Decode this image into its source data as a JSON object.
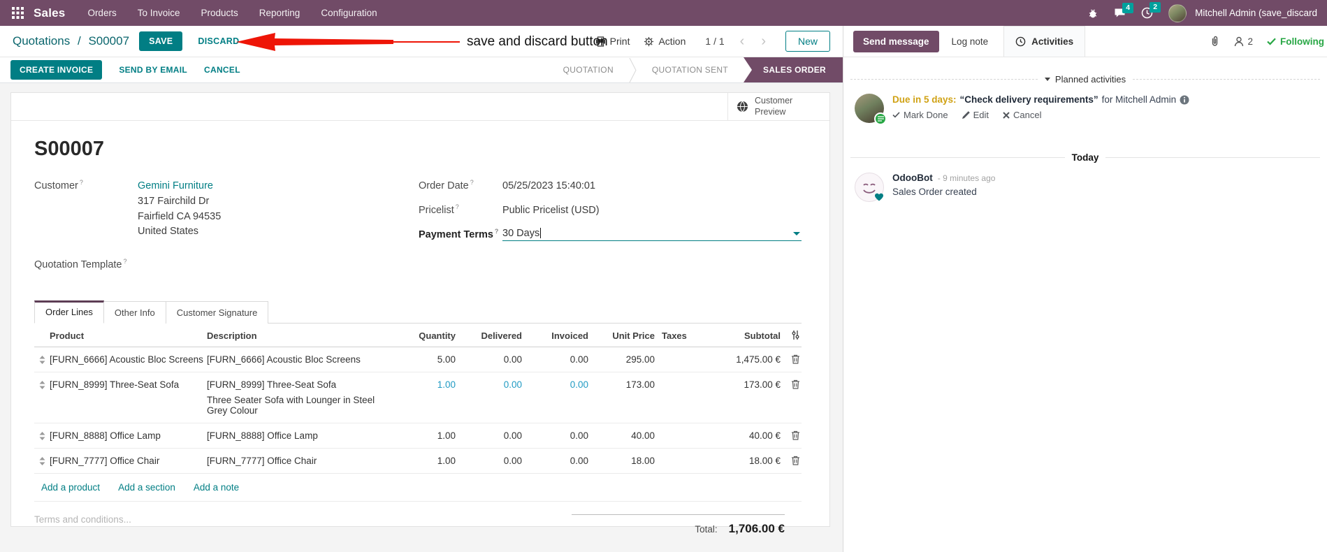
{
  "topnav": {
    "app_name": "Sales",
    "menus": [
      "Orders",
      "To Invoice",
      "Products",
      "Reporting",
      "Configuration"
    ],
    "messages_badge": "4",
    "activities_badge": "2",
    "user_name": "Mitchell Admin (save_discard"
  },
  "control_panel": {
    "breadcrumb_parent": "Quotations",
    "breadcrumb_sep": "/",
    "breadcrumb_current": "S00007",
    "save_label": "SAVE",
    "discard_label": "DISCARD",
    "annotation_text": "save and discard button",
    "print_label": "Print",
    "action_label": "Action",
    "pager": "1 / 1",
    "prev_label": "‹",
    "next_label": "›",
    "new_label": "New"
  },
  "statusbar": {
    "buttons": [
      "CREATE INVOICE",
      "SEND BY EMAIL",
      "CANCEL"
    ],
    "stages": [
      "QUOTATION",
      "QUOTATION SENT",
      "SALES ORDER"
    ],
    "active_stage": "SALES ORDER"
  },
  "sheet": {
    "customer_preview_label": "Customer Preview",
    "title": "S00007",
    "fields": {
      "customer_label": "Customer",
      "customer_name": "Gemini Furniture",
      "customer_address": [
        "317 Fairchild Dr",
        "Fairfield CA 94535",
        "United States"
      ],
      "quotation_template_label": "Quotation Template",
      "order_date_label": "Order Date",
      "order_date": "05/25/2023 15:40:01",
      "pricelist_label": "Pricelist",
      "pricelist": "Public Pricelist (USD)",
      "payment_terms_label": "Payment Terms",
      "payment_terms": "30 Days"
    },
    "tabs": [
      "Order Lines",
      "Other Info",
      "Customer Signature"
    ],
    "order_lines": {
      "columns": [
        "Product",
        "Description",
        "Quantity",
        "Delivered",
        "Invoiced",
        "Unit Price",
        "Taxes",
        "Subtotal"
      ],
      "rows": [
        {
          "product": "[FURN_6666] Acoustic Bloc Screens",
          "description": "[FURN_6666] Acoustic Bloc Screens",
          "description2": "",
          "quantity": "5.00",
          "delivered": "0.00",
          "invoiced": "0.00",
          "unit_price": "295.00",
          "taxes": "",
          "subtotal": "1,475.00 €"
        },
        {
          "product": "[FURN_8999] Three-Seat Sofa",
          "description": "[FURN_8999] Three-Seat Sofa",
          "description2": "Three Seater Sofa with Lounger in Steel Grey Colour",
          "quantity": "1.00",
          "delivered": "0.00",
          "invoiced": "0.00",
          "unit_price": "173.00",
          "taxes": "",
          "subtotal": "173.00 €"
        },
        {
          "product": "[FURN_8888] Office Lamp",
          "description": "[FURN_8888] Office Lamp",
          "description2": "",
          "quantity": "1.00",
          "delivered": "0.00",
          "invoiced": "0.00",
          "unit_price": "40.00",
          "taxes": "",
          "subtotal": "40.00 €"
        },
        {
          "product": "[FURN_7777] Office Chair",
          "description": "[FURN_7777] Office Chair",
          "description2": "",
          "quantity": "1.00",
          "delivered": "0.00",
          "invoiced": "0.00",
          "unit_price": "18.00",
          "taxes": "",
          "subtotal": "18.00 €"
        }
      ],
      "links": [
        "Add a product",
        "Add a section",
        "Add a note"
      ]
    },
    "terms_placeholder": "Terms and conditions...",
    "total_label": "Total:",
    "total_value": "1,706.00 €"
  },
  "chatter": {
    "send_message_label": "Send message",
    "log_note_label": "Log note",
    "activities_label": "Activities",
    "followers_count": "2",
    "following_label": "Following",
    "planned_header": "Planned activities",
    "activity": {
      "due": "Due in 5 days:",
      "summary": "“Check delivery requirements”",
      "for_text": "for Mitchell Admin",
      "mark_done": "Mark Done",
      "edit": "Edit",
      "cancel": "Cancel"
    },
    "today_label": "Today",
    "message": {
      "author": "OdooBot",
      "time": "- 9 minutes ago",
      "body": "Sales Order created"
    }
  },
  "colors": {
    "nav_purple": "#714B67",
    "accent_teal": "#017E84",
    "edited_blue": "#219BC3",
    "warning_amber": "#D0A215",
    "success_green": "#28A745",
    "badge_teal": "#00A09D",
    "annotation_red": "#EE1507"
  }
}
